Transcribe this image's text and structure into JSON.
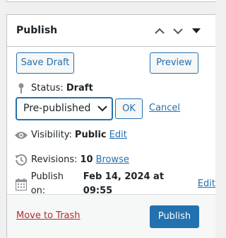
{
  "postbox": {
    "title": "Publish",
    "move_up_icon": "chevron-up-icon",
    "move_down_icon": "chevron-down-icon",
    "toggle_icon": "caret-down-icon"
  },
  "actions_top": {
    "save_draft_label": "Save Draft",
    "preview_label": "Preview"
  },
  "status": {
    "icon": "pin-icon",
    "label": "Status:",
    "value": "Draft",
    "select_value": "Pre-published",
    "ok_label": "OK",
    "cancel_label": "Cancel"
  },
  "visibility": {
    "icon": "eye-icon",
    "label": "Visibility:",
    "value": "Public",
    "edit_label": "Edit"
  },
  "revisions": {
    "icon": "history-icon",
    "label": "Revisions:",
    "value": "10",
    "browse_label": "Browse"
  },
  "schedule": {
    "icon": "calendar-icon",
    "label": "Publish on:",
    "value": "Feb 14, 2024 at 09:55",
    "edit_label": "Edit"
  },
  "actions_bottom": {
    "trash_label": "Move to Trash",
    "publish_label": "Publish"
  },
  "colors": {
    "accent": "#2271b1",
    "danger": "#b32d2e",
    "icon_gray": "#8c8f94"
  }
}
